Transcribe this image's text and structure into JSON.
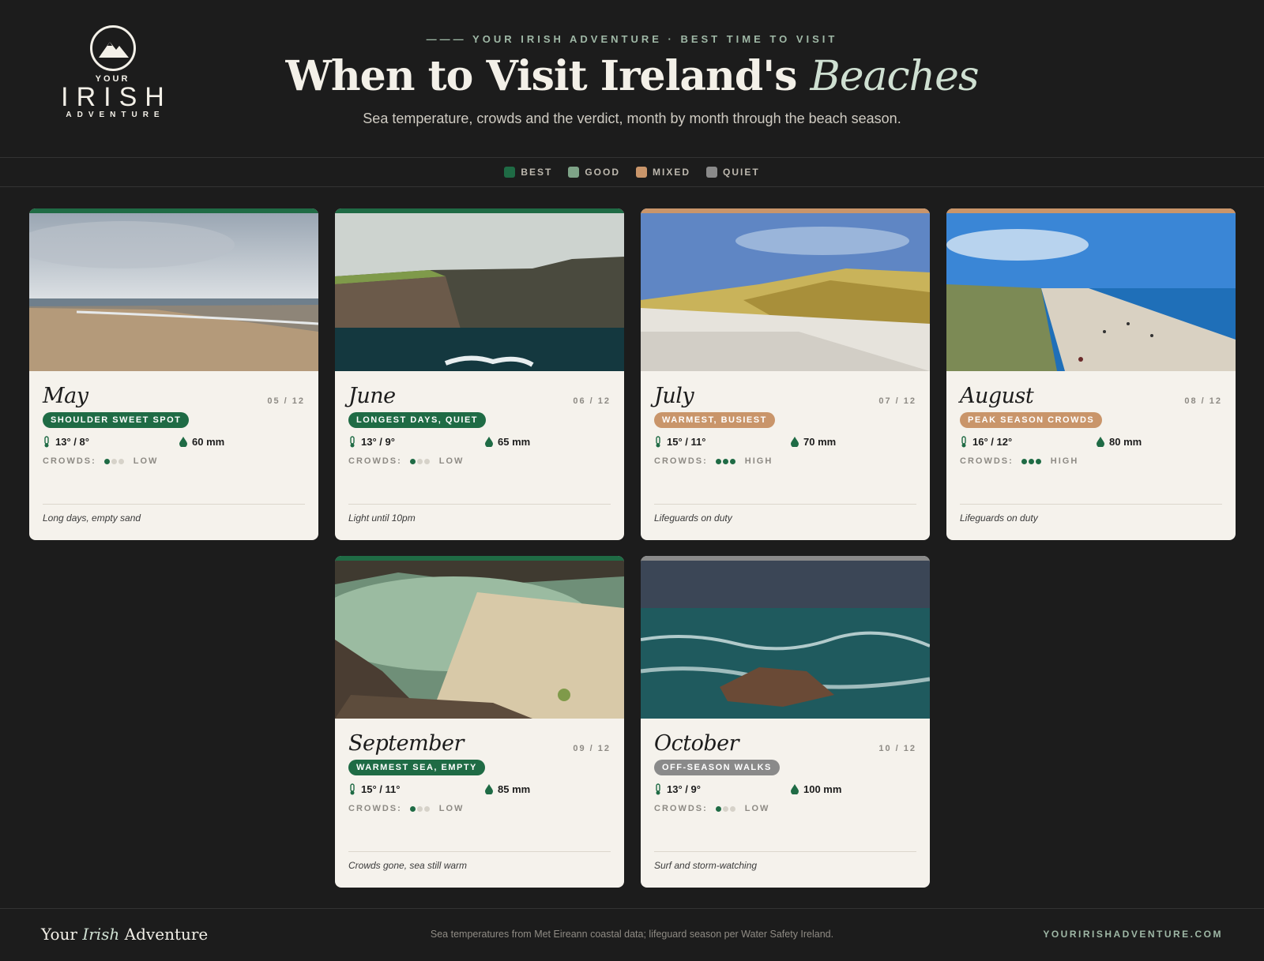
{
  "brand": {
    "your": "YOUR",
    "irish": "IRISH",
    "adventure": "ADVENTURE"
  },
  "header": {
    "eyebrow": "——— YOUR IRISH ADVENTURE · BEST TIME TO VISIT",
    "title_main": "When to Visit Ireland's ",
    "title_emph": "Beaches",
    "subtitle": "Sea temperature, crowds and the verdict, month by month through the beach season."
  },
  "legend": [
    {
      "label": "BEST",
      "color": "#1f6b45"
    },
    {
      "label": "GOOD",
      "color": "#7ea387"
    },
    {
      "label": "MIXED",
      "color": "#c9956a"
    },
    {
      "label": "QUIET",
      "color": "#8a8a8a"
    }
  ],
  "crowds_label": "CROWDS:",
  "cards": [
    {
      "month": "May",
      "num": "05 / 12",
      "badge": "SHOULDER SWEET SPOT",
      "verdict_color": "#1f6b45",
      "temp": "13° / 8°",
      "rain": "60 mm",
      "crowd_level": 1,
      "crowd_text": "LOW",
      "note": "Long days, empty sand"
    },
    {
      "month": "June",
      "num": "06 / 12",
      "badge": "LONGEST DAYS, QUIET",
      "verdict_color": "#1f6b45",
      "temp": "13° / 9°",
      "rain": "65 mm",
      "crowd_level": 1,
      "crowd_text": "LOW",
      "note": "Light until 10pm"
    },
    {
      "month": "July",
      "num": "07 / 12",
      "badge": "WARMEST, BUSIEST",
      "verdict_color": "#c9956a",
      "temp": "15° / 11°",
      "rain": "70 mm",
      "crowd_level": 3,
      "crowd_text": "HIGH",
      "note": "Lifeguards on duty"
    },
    {
      "month": "August",
      "num": "08 / 12",
      "badge": "PEAK SEASON CROWDS",
      "verdict_color": "#c9956a",
      "temp": "16° / 12°",
      "rain": "80 mm",
      "crowd_level": 3,
      "crowd_text": "HIGH",
      "note": "Lifeguards on duty"
    },
    {
      "month": "September",
      "num": "09 / 12",
      "badge": "WARMEST SEA, EMPTY",
      "verdict_color": "#1f6b45",
      "temp": "15° / 11°",
      "rain": "85 mm",
      "crowd_level": 1,
      "crowd_text": "LOW",
      "note": "Crowds gone, sea still warm"
    },
    {
      "month": "October",
      "num": "10 / 12",
      "badge": "OFF-SEASON WALKS",
      "verdict_color": "#8a8a8a",
      "temp": "13° / 9°",
      "rain": "100 mm",
      "crowd_level": 1,
      "crowd_text": "LOW",
      "note": "Surf and storm-watching"
    }
  ],
  "footer": {
    "brand_a": "Your ",
    "brand_b": "Irish",
    "brand_c": " Adventure",
    "source": "Sea temperatures from Met Eireann coastal data; lifeguard season per Water Safety Ireland.",
    "url": "YOURIRISHADVENTURE.COM"
  }
}
